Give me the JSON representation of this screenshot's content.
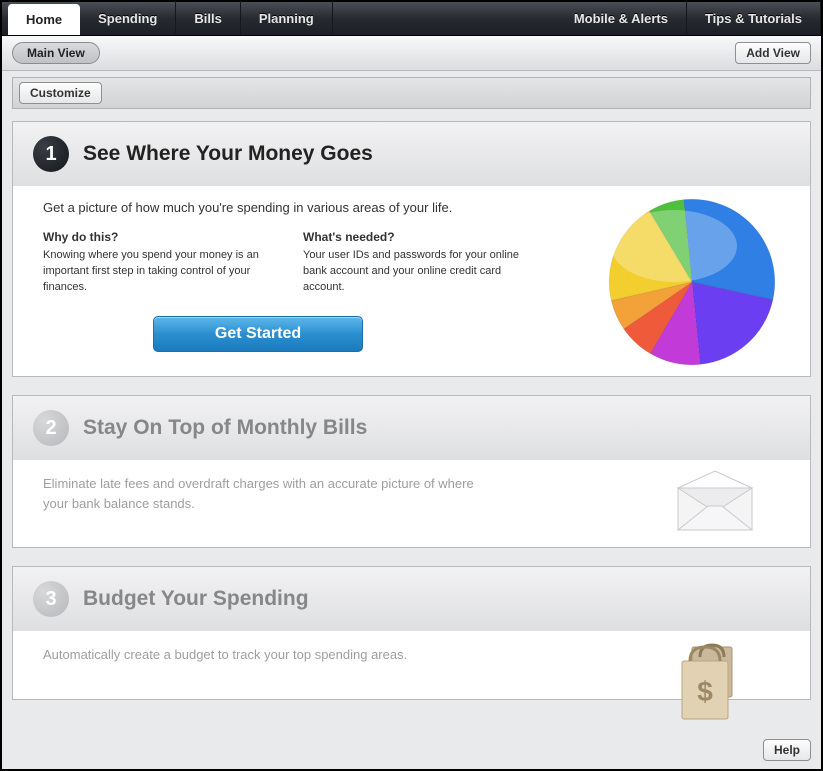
{
  "tabs": {
    "home": "Home",
    "spending": "Spending",
    "bills": "Bills",
    "planning": "Planning",
    "mobile": "Mobile & Alerts",
    "tips": "Tips & Tutorials"
  },
  "subbar": {
    "main_view": "Main View",
    "add_view": "Add View"
  },
  "customize": "Customize",
  "card1": {
    "num": "1",
    "title": "See Where Your Money Goes",
    "lead": "Get a picture of how much you're spending in various areas of your life.",
    "why_h": "Why do this?",
    "why_b": "Knowing where you spend your money is an important first step in taking control of your finances.",
    "need_h": "What's needed?",
    "need_b": "Your user IDs and passwords for your online bank account and your online credit card account.",
    "cta": "Get Started"
  },
  "card2": {
    "num": "2",
    "title": "Stay On Top of Monthly Bills",
    "lead": "Eliminate late fees and overdraft charges with an accurate picture of where your bank balance stands."
  },
  "card3": {
    "num": "3",
    "title": "Budget Your Spending",
    "lead": "Automatically create a budget to track your top spending areas."
  },
  "footer": {
    "help": "Help"
  },
  "chart_data": {
    "type": "pie",
    "title": "",
    "slices": [
      {
        "name": "blue",
        "value": 30,
        "color": "#2f7fe4"
      },
      {
        "name": "violet",
        "value": 20,
        "color": "#6b3ef2"
      },
      {
        "name": "magenta",
        "value": 10,
        "color": "#c23bd8"
      },
      {
        "name": "red",
        "value": 7,
        "color": "#ef5a3a"
      },
      {
        "name": "orange",
        "value": 6,
        "color": "#f3a23a"
      },
      {
        "name": "yellow",
        "value": 20,
        "color": "#f2cf2e"
      },
      {
        "name": "green",
        "value": 7,
        "color": "#4fbf3d"
      }
    ]
  }
}
